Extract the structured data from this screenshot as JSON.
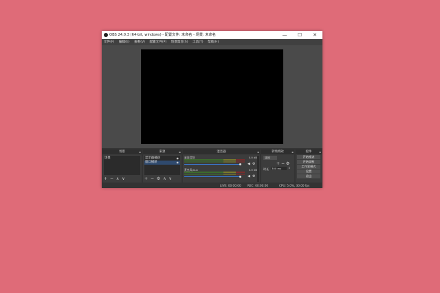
{
  "window": {
    "title": "OBS 24.0.3 (64-bit, windows) - 配置文件: 未命名 - 场景: 未命名",
    "controls": {
      "minimize": "—",
      "maximize": "☐",
      "close": "✕"
    }
  },
  "menu": [
    "文件(F)",
    "编辑(E)",
    "查看(V)",
    "配置文件(P)",
    "场景集合(S)",
    "工具(T)",
    "帮助(H)"
  ],
  "docks": {
    "scenes": {
      "title": "场景",
      "items": [
        "场景"
      ]
    },
    "sources": {
      "title": "来源",
      "items": [
        "显示器捕获",
        "窗口捕获"
      ]
    },
    "mixer": {
      "title": "混音器",
      "channels": [
        {
          "name": "桌面音频",
          "db": "0.0 dB"
        },
        {
          "name": "麦克风/Aux",
          "db": "0.0 dB"
        }
      ]
    },
    "transitions": {
      "title": "转场特效",
      "selected": "淡出",
      "duration_label": "时长",
      "duration_value": "300 ms"
    },
    "controls": {
      "title": "控件",
      "buttons": [
        "开始推流",
        "开始录制",
        "工作室模式",
        "设置",
        "退出"
      ]
    },
    "toolbar_glyphs": {
      "add": "+",
      "remove": "−",
      "gear": "⚙",
      "up": "∧",
      "down": "∨"
    }
  },
  "status": {
    "live": "LIVE: 00:00:00",
    "rec": "REC: 00:00:00",
    "cpu": "CPU: 5.0%, 30.00 fps"
  }
}
